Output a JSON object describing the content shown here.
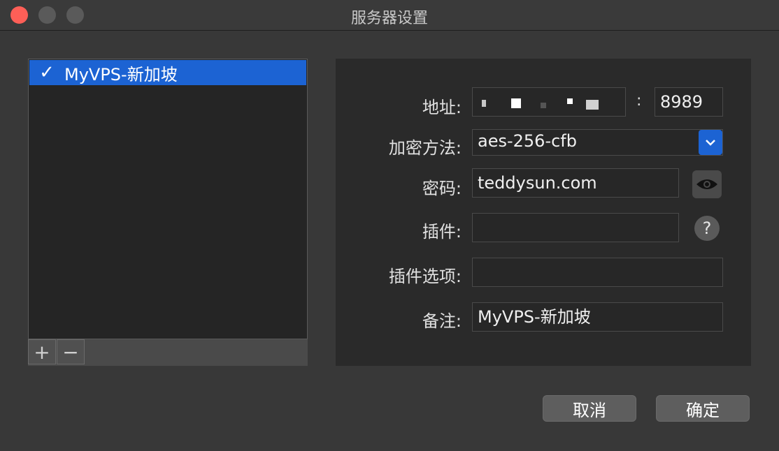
{
  "window": {
    "title": "服务器设置"
  },
  "server_list": {
    "items": [
      {
        "label": "MyVPS-新加坡",
        "selected": true
      }
    ],
    "add_label": "+",
    "remove_label": "−"
  },
  "form": {
    "address_label": "地址:",
    "address_value": "",
    "port_separator": ":",
    "port_value": "8989",
    "encryption_label": "加密方法:",
    "encryption_value": "aes-256-cfb",
    "password_label": "密码:",
    "password_value": "teddysun.com",
    "plugin_label": "插件:",
    "plugin_value": "",
    "plugin_options_label": "插件选项:",
    "plugin_options_value": "",
    "remark_label": "备注:",
    "remark_value": "MyVPS-新加坡"
  },
  "icons": {
    "check": "checkmark-icon",
    "eye": "eye-icon",
    "help": "help-icon",
    "dropdown": "chevron-down-icon"
  },
  "colors": {
    "accent": "#1c63d3",
    "close": "#fe5f57"
  },
  "buttons": {
    "cancel": "取消",
    "ok": "确定"
  }
}
